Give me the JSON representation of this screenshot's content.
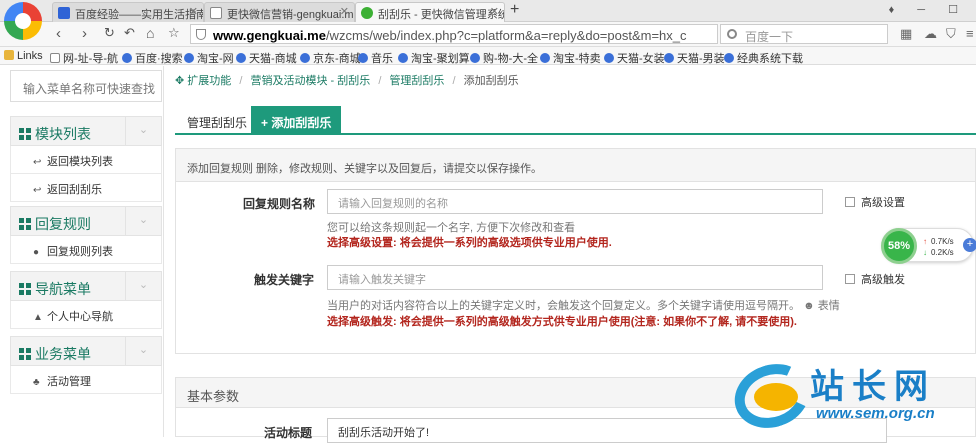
{
  "browser": {
    "tabs": [
      {
        "label": "百度经验——实用生活指南",
        "icon_color": "#2f63d6"
      },
      {
        "label": "更快微信营销-gengkuai.me",
        "icon_color": "#888888"
      },
      {
        "label": "刮刮乐 - 更快微信管理系统",
        "icon_color": "#3cb034"
      }
    ],
    "new_tab": "+",
    "address": {
      "domain": "www.gengkuai.me",
      "path": "/wzcms/web/index.php?c=platform&a=reply&do=post&m=hx_c"
    },
    "search_placeholder": "百度一下",
    "bookmarks": [
      {
        "label": "Links",
        "color": "#e8b53c"
      },
      {
        "label": "网-址-导-航",
        "color": "#888888"
      },
      {
        "label": "百度·搜索",
        "color": "#3a6fd8"
      },
      {
        "label": "淘宝-网",
        "color": "#3a6fd8"
      },
      {
        "label": "天猫-商城",
        "color": "#3a6fd8"
      },
      {
        "label": "京东-商城",
        "color": "#3a6fd8"
      },
      {
        "label": "音乐",
        "color": "#3a6fd8"
      },
      {
        "label": "淘宝-聚划算",
        "color": "#3a6fd8"
      },
      {
        "label": "购-物-大-全",
        "color": "#3a6fd8"
      },
      {
        "label": "淘宝-特卖",
        "color": "#3a6fd8"
      },
      {
        "label": "天猫-女装",
        "color": "#3a6fd8"
      },
      {
        "label": "天猫-男装",
        "color": "#3a6fd8"
      },
      {
        "label": "经典系统下载",
        "color": "#3a6fd8"
      }
    ]
  },
  "sidebar": {
    "search_placeholder": "输入菜单名称可快速查找",
    "groups": [
      {
        "title": "模块列表",
        "items": [
          "返回模块列表",
          "返回刮刮乐"
        ]
      },
      {
        "title": "回复规则",
        "items": [
          "回复规则列表"
        ]
      },
      {
        "title": "导航菜单",
        "items": [
          "个人中心导航"
        ]
      },
      {
        "title": "业务菜单",
        "items": [
          "活动管理"
        ]
      }
    ]
  },
  "breadcrumb": {
    "items": [
      "扩展功能",
      "营销及活动模块 - 刮刮乐",
      "管理刮刮乐"
    ],
    "current": "添加刮刮乐",
    "sep": "/"
  },
  "tabs": {
    "manage": "管理刮刮乐",
    "add": "添加刮刮乐"
  },
  "form": {
    "heading_strong": "添加回复规则",
    "heading_rest": " 删除，修改规则、关键字以及回复后，请提交以保存操作。",
    "rule_name": {
      "label": "回复规则名称",
      "placeholder": "请输入回复规则的名称",
      "help": "您可以给这条规则起一个名字, 方便下次修改和查看",
      "warn": "选择高级设置: 将会提供一系列的高级选项供专业用户使用.",
      "checkbox": "高级设置"
    },
    "keyword": {
      "label": "触发关键字",
      "placeholder": "请输入触发关键字",
      "help": "当用户的对话内容符合以上的关键字定义时，会触发这个回复定义。多个关键字请使用逗号隔开。",
      "help_link": "表情",
      "warn": "选择高级触发: 将会提供一系列的高级触发方式供专业用户使用(注意: 如果你不了解, 请不要使用).",
      "checkbox": "高级触发"
    }
  },
  "basic": {
    "title": "基本参数",
    "activity_label": "活动标题",
    "activity_value": "刮刮乐活动开始了!"
  },
  "speed_widget": {
    "percent": "58%",
    "up": "0.7K/s",
    "down": "0.2K/s"
  },
  "watermark": {
    "cn": "站长网",
    "en": "www.sem.org.cn"
  }
}
